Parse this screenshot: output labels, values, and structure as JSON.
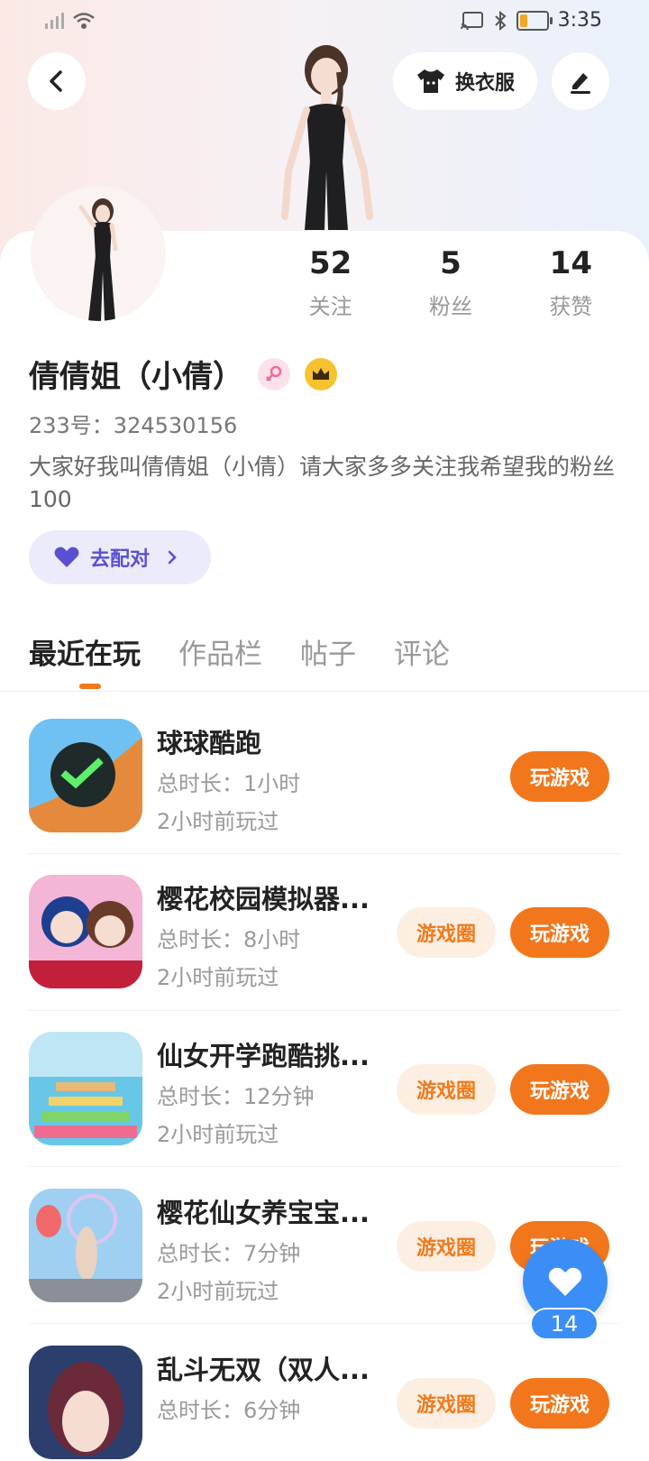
{
  "status_bar": {
    "time": "3:35",
    "battery_level": 0.3,
    "icons": [
      "signal-icon",
      "wifi-icon",
      "cast-icon",
      "bluetooth-icon",
      "battery-icon"
    ]
  },
  "header": {
    "outfit_label": "换衣服"
  },
  "stats": [
    {
      "value": "52",
      "label": "关注"
    },
    {
      "value": "5",
      "label": "粉丝"
    },
    {
      "value": "14",
      "label": "获赞"
    }
  ],
  "profile": {
    "name": "倩倩姐（小倩）",
    "uid": "233号：324530156",
    "bio": "大家好我叫倩倩姐（小倩）请大家多多关注我希望我的粉丝100",
    "match_label": "去配对"
  },
  "tabs": [
    {
      "label": "最近在玩",
      "active": true
    },
    {
      "label": "作品栏",
      "active": false
    },
    {
      "label": "帖子",
      "active": false
    },
    {
      "label": "评论",
      "active": false
    }
  ],
  "games": [
    {
      "title": "球球酷跑",
      "duration": "总时长：1小时",
      "last_played": "2小时前玩过",
      "has_circle": false,
      "circle_label": "",
      "play_label": "玩游戏"
    },
    {
      "title": "樱花校园模拟器...",
      "duration": "总时长：8小时",
      "last_played": "2小时前玩过",
      "has_circle": true,
      "circle_label": "游戏圈",
      "play_label": "玩游戏"
    },
    {
      "title": "仙女开学跑酷挑...",
      "duration": "总时长：12分钟",
      "last_played": "2小时前玩过",
      "has_circle": true,
      "circle_label": "游戏圈",
      "play_label": "玩游戏"
    },
    {
      "title": "樱花仙女养宝宝...",
      "duration": "总时长：7分钟",
      "last_played": "2小时前玩过",
      "has_circle": true,
      "circle_label": "游戏圈",
      "play_label": "玩游戏"
    },
    {
      "title": "乱斗无双（双人...",
      "duration": "总时长：6分钟",
      "last_played": "",
      "has_circle": true,
      "circle_label": "游戏圈",
      "play_label": "玩游戏"
    }
  ],
  "fab": {
    "count": "14"
  },
  "colors": {
    "accent": "#f2761c",
    "fab": "#3a8ef5",
    "match": "#5a4fd0"
  }
}
